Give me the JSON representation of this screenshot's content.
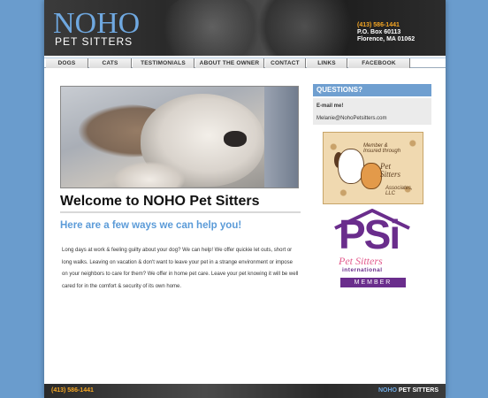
{
  "header": {
    "logo_main": "NOHO",
    "logo_sub": "PET SITTERS",
    "phone": "(413) 586-1441",
    "po_box": "P.O. Box 60113",
    "city": "Florence, MA 01062"
  },
  "nav": {
    "items": [
      {
        "label": "DOGS"
      },
      {
        "label": "CATS"
      },
      {
        "label": "TESTIMONIALS"
      },
      {
        "label": "ABOUT THE OWNER"
      },
      {
        "label": "CONTACT"
      },
      {
        "label": "LINKS"
      },
      {
        "label": "FACEBOOK"
      }
    ]
  },
  "main": {
    "welcome": "Welcome to NOHO Pet Sitters",
    "help": "Here are a few ways we can help you!",
    "body": "Long days at work & feeling guilty about your dog? We can help! We offer quickie let outs, short or long walks. Leaving on vacation & don't want to leave your pet in a strange environment or impose on your neighbors to care for them? We offer in home pet care. Leave your pet knowing it will be well cared for in the comfort & security of its own home."
  },
  "sidebar": {
    "questions_title": "QUESTIONS?",
    "email_label": "E-mail me!",
    "email": "Melanie@NohoPetsitters.com",
    "badge1": {
      "line1": "Member &",
      "line2": "Insured through",
      "brand1": "Pet",
      "brand2": "Sitters",
      "brand3": "Associates, LLC"
    },
    "psi": {
      "logo": "PSi",
      "name": "Pet Sitters",
      "org": "international",
      "member": "MEMBER"
    }
  },
  "footer": {
    "phone": "(413) 586-1441",
    "brand_a": "NOHO",
    "brand_b": " PET SITTERS"
  },
  "colors": {
    "accent_blue": "#6f9fd0",
    "heading_blue": "#5b9bd8",
    "phone_orange": "#f5a623",
    "psi_purple": "#6a2d8c"
  }
}
